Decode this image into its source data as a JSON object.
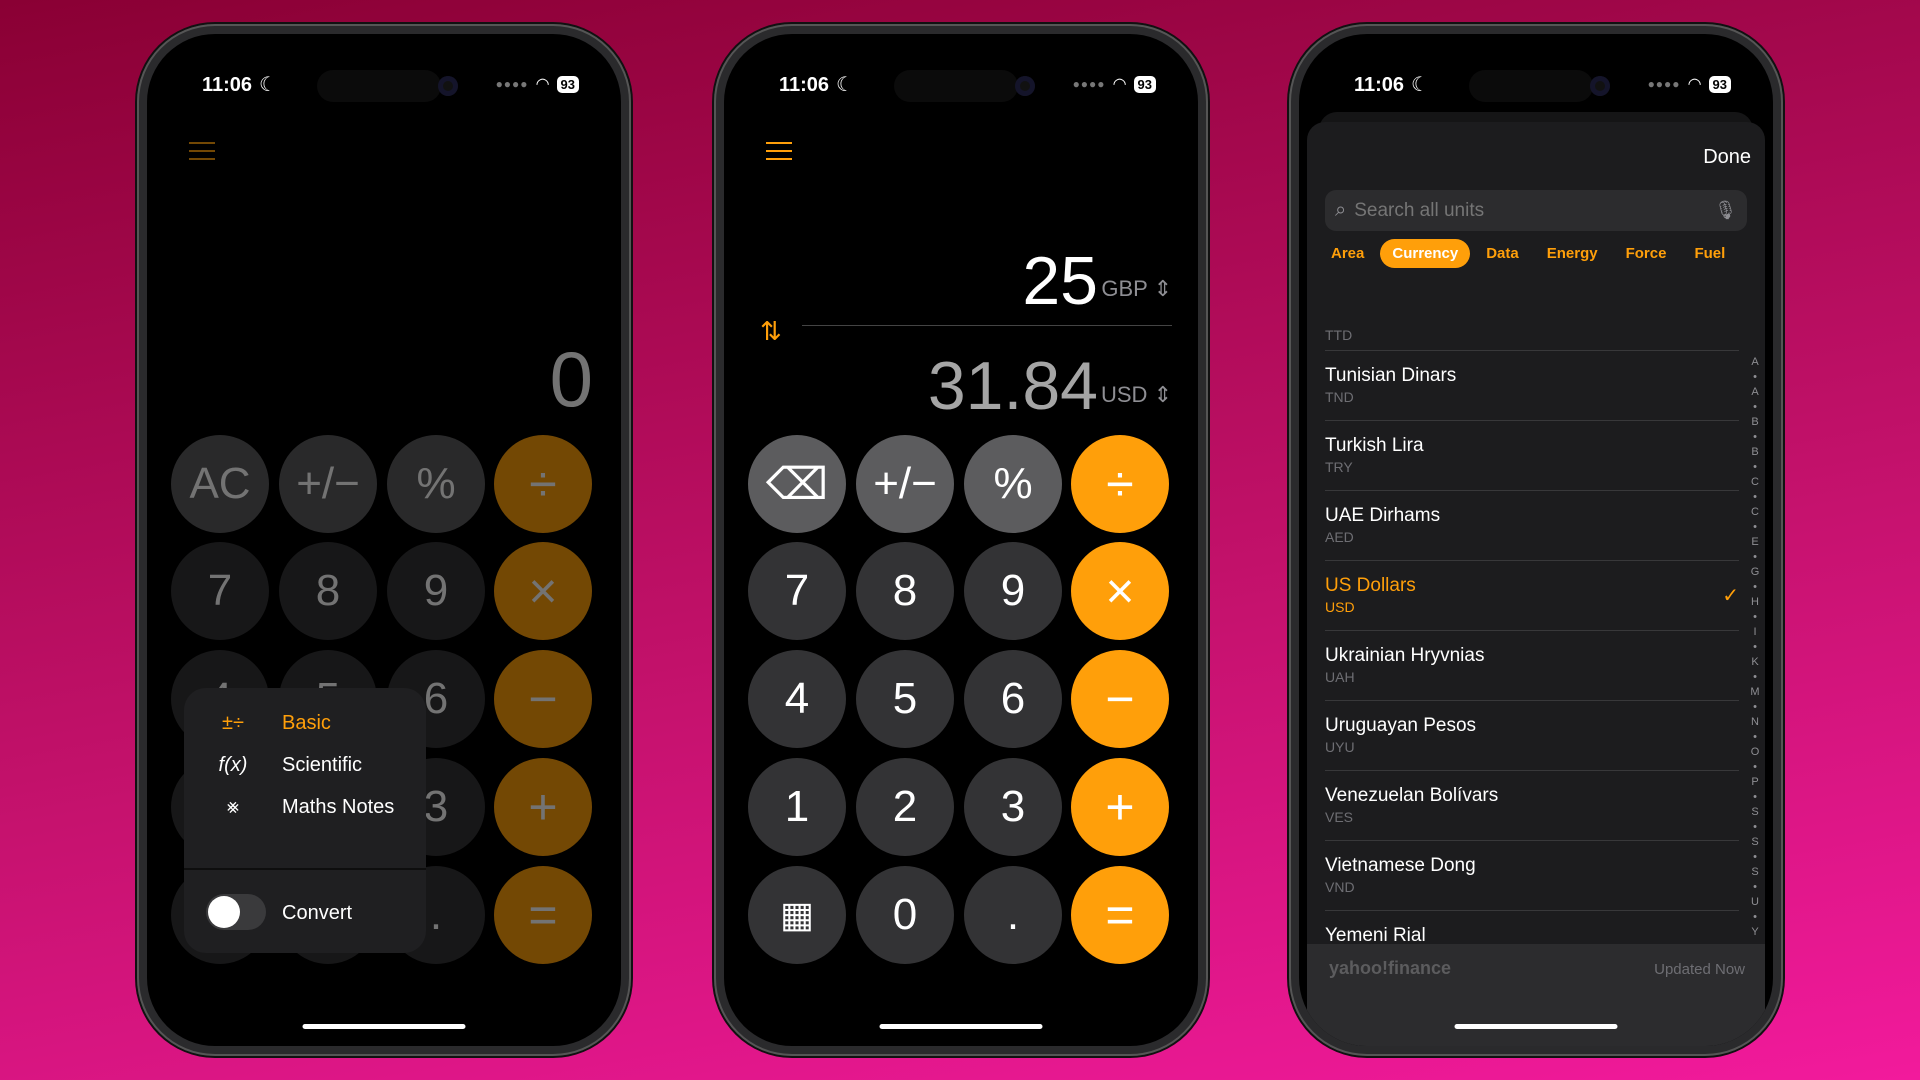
{
  "status": {
    "time": "11:06",
    "battery": "93"
  },
  "colors": {
    "accent": "#ff9f0a",
    "background_top": "#8a0034",
    "background_bottom": "#f21a9c"
  },
  "phone1": {
    "display": "0",
    "keys": [
      [
        "AC",
        "+/−",
        "%",
        "÷"
      ],
      [
        "7",
        "8",
        "9",
        "×"
      ],
      [
        "4",
        "5",
        "6",
        "−"
      ],
      [
        "1",
        "2",
        "3",
        "+"
      ],
      [
        "calculator",
        "0",
        ".",
        "="
      ]
    ],
    "menu": {
      "items": [
        {
          "icon": "basic-operators-icon",
          "glyph": "±÷",
          "label": "Basic",
          "selected": true
        },
        {
          "icon": "function-icon",
          "glyph": "f(x)",
          "label": "Scientific",
          "selected": false
        },
        {
          "icon": "maths-notes-icon",
          "glyph": "⨳",
          "label": "Maths Notes",
          "selected": false
        }
      ],
      "toggle_label": "Convert",
      "toggle_on": false
    }
  },
  "phone2": {
    "from_value": "25",
    "from_unit": "GBP",
    "to_value": "31.84",
    "to_unit": "USD",
    "keys": [
      [
        "⌫",
        "+/−",
        "%",
        "÷"
      ],
      [
        "7",
        "8",
        "9",
        "×"
      ],
      [
        "4",
        "5",
        "6",
        "−"
      ],
      [
        "1",
        "2",
        "3",
        "+"
      ],
      [
        "calculator",
        "0",
        ".",
        "="
      ]
    ]
  },
  "phone3": {
    "done_label": "Done",
    "search_placeholder": "Search all units",
    "tabs": [
      {
        "label": "Area"
      },
      {
        "label": "Currency",
        "selected": true
      },
      {
        "label": "Data"
      },
      {
        "label": "Energy"
      },
      {
        "label": "Force"
      },
      {
        "label": "Fuel"
      }
    ],
    "partial_code": "TTD",
    "currencies": [
      {
        "name": "Tunisian Dinars",
        "code": "TND"
      },
      {
        "name": "Turkish Lira",
        "code": "TRY"
      },
      {
        "name": "UAE Dirhams",
        "code": "AED"
      },
      {
        "name": "US Dollars",
        "code": "USD",
        "selected": true
      },
      {
        "name": "Ukrainian Hryvnias",
        "code": "UAH"
      },
      {
        "name": "Uruguayan Pesos",
        "code": "UYU"
      },
      {
        "name": "Venezuelan Bolívars",
        "code": "VES"
      },
      {
        "name": "Vietnamese Dong",
        "code": "VND"
      },
      {
        "name": "Yemeni Rial",
        "code": "YER"
      }
    ],
    "index_letters": [
      "A",
      "A",
      "B",
      "B",
      "C",
      "C",
      "E",
      "G",
      "H",
      "I",
      "K",
      "M",
      "N",
      "O",
      "P",
      "S",
      "S",
      "S",
      "U",
      "Y"
    ],
    "footer_logo": "yahoo!finance",
    "footer_status": "Updated Now"
  }
}
